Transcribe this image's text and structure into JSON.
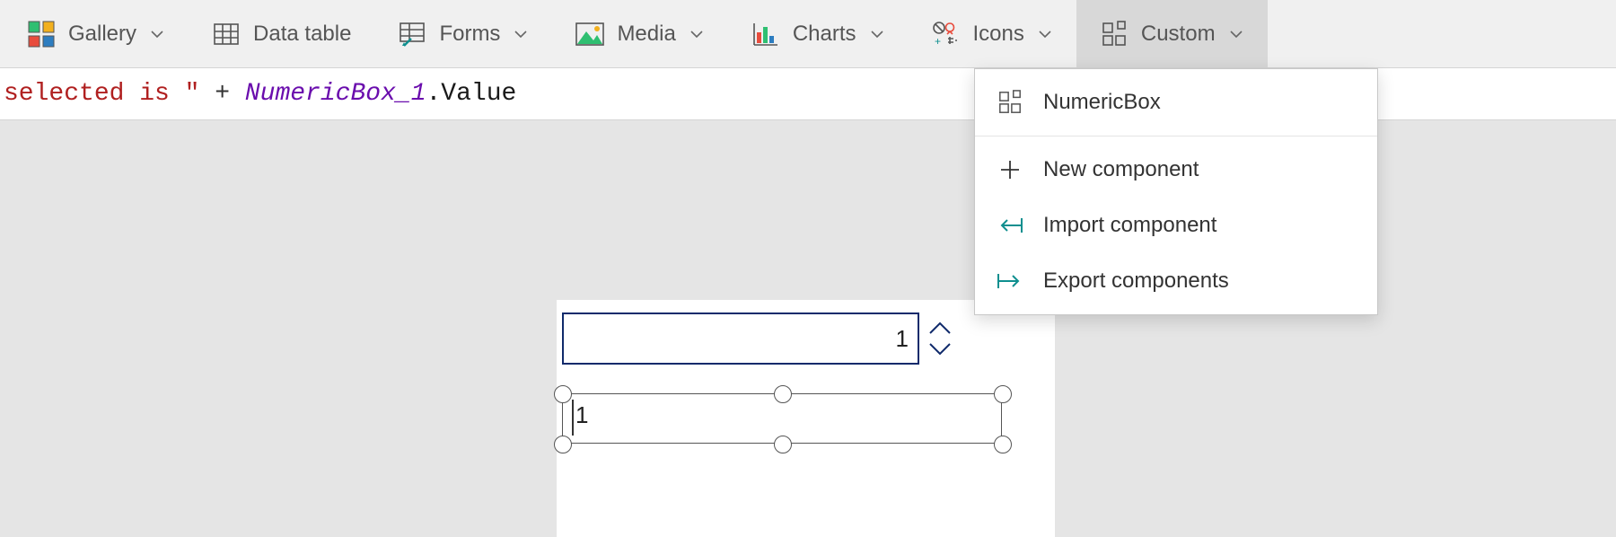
{
  "ribbon": {
    "gallery": {
      "label": "Gallery"
    },
    "datatable": {
      "label": "Data table"
    },
    "forms": {
      "label": "Forms"
    },
    "media": {
      "label": "Media"
    },
    "charts": {
      "label": "Charts"
    },
    "icons": {
      "label": "Icons"
    },
    "custom": {
      "label": "Custom"
    }
  },
  "formula": {
    "part1": "selected is \"",
    "op": " + ",
    "ident": "NumericBox_1",
    "suffix": ".Value"
  },
  "dropdown": {
    "item_numericbox": "NumericBox",
    "item_newcomponent": "New component",
    "item_import": "Import component",
    "item_export": "Export components"
  },
  "canvas": {
    "numeric_value": "1",
    "selected_value": "1"
  },
  "colors": {
    "accent_dark_blue": "#102a6b",
    "teal": "#0f8f8f"
  }
}
